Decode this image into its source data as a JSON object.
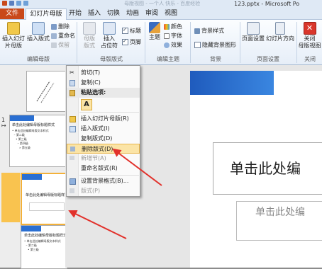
{
  "window": {
    "title": "123.pptx - Microsoft Po",
    "title_faded": "母版视图 - 一个人 快乐 - 百度经验"
  },
  "tabs": [
    {
      "label": "文件"
    },
    {
      "label": "幻灯片母版"
    },
    {
      "label": "开始"
    },
    {
      "label": "插入"
    },
    {
      "label": "切换"
    },
    {
      "label": "动画"
    },
    {
      "label": "审阅"
    },
    {
      "label": "视图"
    }
  ],
  "ribbon": {
    "edit_master": {
      "insert_master": "插入幻灯\n片母版",
      "insert_layout": "插入版式",
      "delete": "删除",
      "rename": "重命名",
      "preserve": "保留",
      "group_label": "编辑母版"
    },
    "master_layout": {
      "master_layout_btn": "母版\n版式",
      "insert_placeholder": "插入\n占位符",
      "title_check": "标题",
      "footer_check": "页脚",
      "group_label": "母版版式"
    },
    "edit_theme": {
      "themes": "主题",
      "colors": "颜色",
      "fonts": "字体",
      "effects": "效果",
      "group_label": "编辑主题"
    },
    "background": {
      "background_styles": "背景样式",
      "hide_background": "隐藏背景图形",
      "group_label": "背景"
    },
    "page_setup": {
      "page_setup_btn": "页面设置",
      "orientation": "幻灯片方向",
      "group_label": "页面设置"
    },
    "close": {
      "close_btn": "关闭\n母版视图",
      "group_label": "关闭"
    }
  },
  "context_menu": {
    "items": [
      {
        "label": "剪切(T)",
        "enabled": true
      },
      {
        "label": "复制(C)",
        "enabled": true
      },
      {
        "label": "粘贴选项:",
        "enabled": true,
        "bold": true
      },
      {
        "label": "A",
        "enabled": true
      },
      {
        "label": "插入幻灯片母版(R)",
        "enabled": true
      },
      {
        "label": "插入版式(I)",
        "enabled": true
      },
      {
        "label": "复制版式(D)",
        "enabled": true
      },
      {
        "label": "删除版式(D)",
        "enabled": true,
        "highlighted": true
      },
      {
        "label": "新增节(A)",
        "enabled": false
      },
      {
        "label": "重命名版式(R)",
        "enabled": true
      },
      {
        "label": "设置背景格式(B)...",
        "enabled": true
      },
      {
        "label": "版式(P)",
        "enabled": false
      }
    ]
  },
  "thumbnails": [
    {
      "index": "1",
      "title": "单击此处编辑母版标题样式",
      "body": "• 单击此处编辑母版文本样式\n  – 第二级\n    • 第三级\n      – 第四级\n        » 第五级"
    },
    {
      "index": "",
      "title": "单击此处编辑母版标题样式",
      "body": ""
    },
    {
      "index": "",
      "title": "单击此处编辑母版标题样式",
      "body": "• 单击此处编辑母版文本样式\n  – 第二级\n    • 第三级"
    }
  ],
  "slide": {
    "title_placeholder": "单击此处编",
    "subtitle_placeholder": "单击此处编"
  },
  "colors": {
    "file_tab": "#c9491a",
    "highlight": "#fbe4a6",
    "arrow": "#e2312b",
    "slide_accent": "#2a6fd2"
  }
}
